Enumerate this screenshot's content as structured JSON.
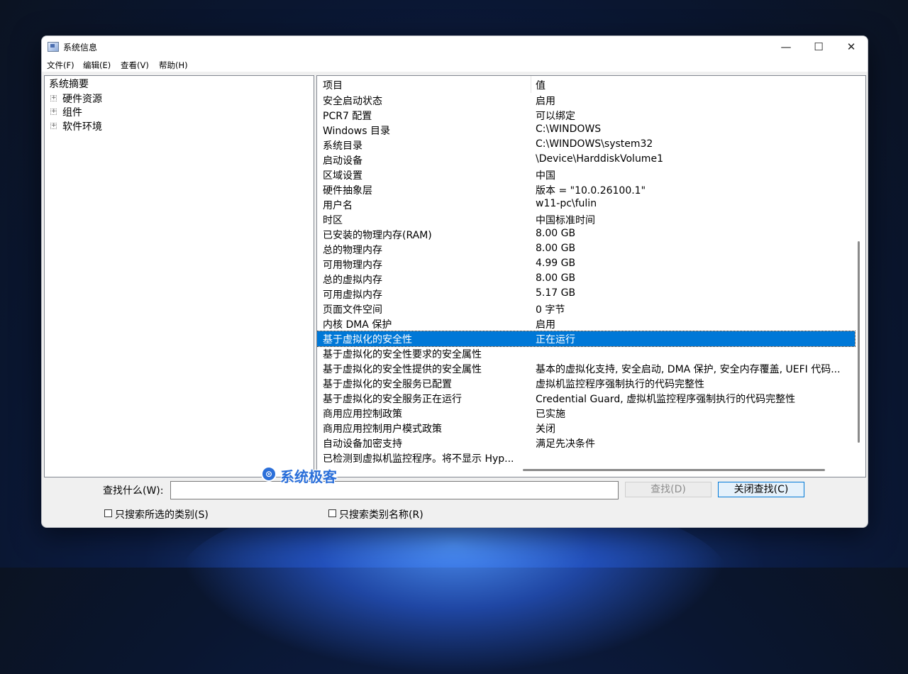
{
  "window": {
    "title": "系统信息",
    "controls": {
      "minimize": "—",
      "maximize": "☐",
      "close": "✕"
    }
  },
  "menu": [
    "文件(F)",
    "编辑(E)",
    "查看(V)",
    "帮助(H)"
  ],
  "tree": {
    "root": "系统摘要",
    "nodes": [
      {
        "label": "硬件资源",
        "expander": "+"
      },
      {
        "label": "组件",
        "expander": "+"
      },
      {
        "label": "软件环境",
        "expander": "+"
      }
    ]
  },
  "list": {
    "col_item": "项目",
    "col_value": "值",
    "rows": [
      {
        "item": "安全启动状态",
        "value": "启用"
      },
      {
        "item": "PCR7 配置",
        "value": "可以绑定"
      },
      {
        "item": "Windows 目录",
        "value": "C:\\WINDOWS"
      },
      {
        "item": "系统目录",
        "value": "C:\\WINDOWS\\system32"
      },
      {
        "item": "启动设备",
        "value": "\\Device\\HarddiskVolume1"
      },
      {
        "item": "区域设置",
        "value": "中国"
      },
      {
        "item": "硬件抽象层",
        "value": "版本 = \"10.0.26100.1\""
      },
      {
        "item": "用户名",
        "value": "w11-pc\\fulin"
      },
      {
        "item": "时区",
        "value": "中国标准时间"
      },
      {
        "item": "已安装的物理内存(RAM)",
        "value": "8.00 GB"
      },
      {
        "item": "总的物理内存",
        "value": "8.00 GB"
      },
      {
        "item": "可用物理内存",
        "value": "4.99 GB"
      },
      {
        "item": "总的虚拟内存",
        "value": "8.00 GB"
      },
      {
        "item": "可用虚拟内存",
        "value": "5.17 GB"
      },
      {
        "item": "页面文件空间",
        "value": "0 字节"
      },
      {
        "item": "内核 DMA 保护",
        "value": "启用"
      },
      {
        "item": "基于虚拟化的安全性",
        "value": "正在运行"
      },
      {
        "item": "基于虚拟化的安全性要求的安全属性",
        "value": ""
      },
      {
        "item": "基于虚拟化的安全性提供的安全属性",
        "value": "基本的虚拟化支持, 安全启动, DMA 保护, 安全内存覆盖, UEFI 代码..."
      },
      {
        "item": "基于虚拟化的安全服务已配置",
        "value": "虚拟机监控程序强制执行的代码完整性"
      },
      {
        "item": "基于虚拟化的安全服务正在运行",
        "value": "Credential Guard, 虚拟机监控程序强制执行的代码完整性"
      },
      {
        "item": "商用应用控制政策",
        "value": "已实施"
      },
      {
        "item": "商用应用控制用户模式政策",
        "value": "关闭"
      },
      {
        "item": "自动设备加密支持",
        "value": "满足先决条件"
      },
      {
        "item": "已检测到虚拟机监控程序。将不显示 Hyp...",
        "value": ""
      }
    ],
    "selected_index": 16
  },
  "find": {
    "label": "查找什么(W):",
    "value": "",
    "find_button": "查找(D)",
    "close_button": "关闭查找(C)",
    "check_selected": "只搜索所选的类别(S)",
    "check_names": "只搜索类别名称(R)"
  },
  "watermark": {
    "logo": "⊙",
    "text": "系统极客"
  }
}
